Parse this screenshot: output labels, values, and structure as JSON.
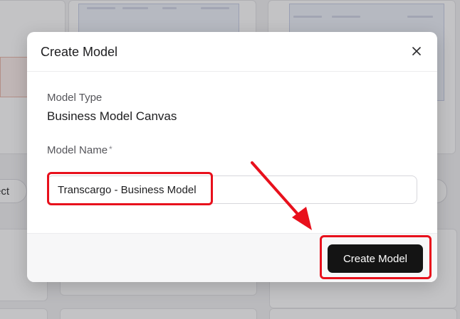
{
  "background": {
    "select_pill_label": "ect"
  },
  "modal": {
    "title": "Create Model",
    "model_type_label": "Model Type",
    "model_type_value": "Business Model Canvas",
    "model_name_label": "Model Name",
    "required_marker": "*",
    "model_name_value": "Transcargo - Business Model",
    "create_button_label": "Create Model"
  },
  "icons": {
    "close": "close-icon"
  },
  "colors": {
    "annotation_red": "#e8101c",
    "primary_button": "#141414"
  }
}
